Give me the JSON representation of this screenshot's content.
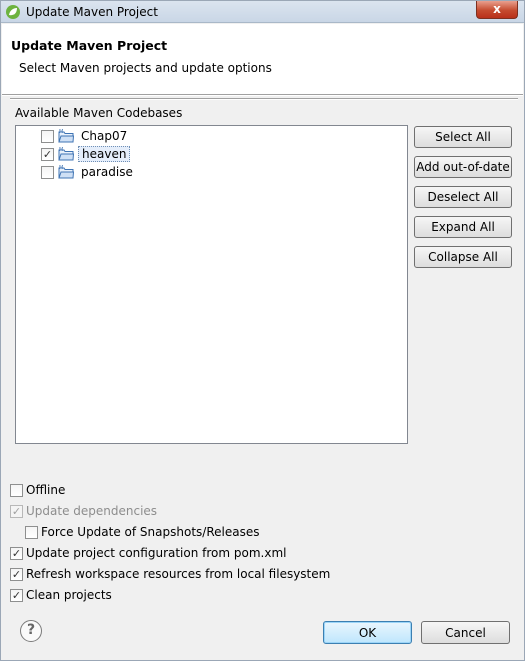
{
  "window": {
    "title": "Update Maven Project",
    "close_glyph": "x"
  },
  "header": {
    "title": "Update Maven Project",
    "subtitle": "Select Maven projects and update options"
  },
  "codebases": {
    "label": "Available Maven Codebases",
    "items": [
      {
        "label": "Chap07",
        "checked": false,
        "selected": false
      },
      {
        "label": "heaven",
        "checked": true,
        "selected": true
      },
      {
        "label": "paradise",
        "checked": false,
        "selected": false
      }
    ]
  },
  "side_buttons": {
    "select_all": "Select All",
    "add_out_of_date": "Add out-of-date",
    "deselect_all": "Deselect All",
    "expand_all": "Expand All",
    "collapse_all": "Collapse All"
  },
  "options": {
    "offline": {
      "label": "Offline",
      "checked": false
    },
    "update_dependencies": {
      "label": "Update dependencies",
      "checked": true,
      "enabled": false
    },
    "force_update": {
      "label": "Force Update of Snapshots/Releases",
      "checked": false
    },
    "update_config": {
      "label": "Update project configuration from pom.xml",
      "checked": true
    },
    "refresh_workspace": {
      "label": "Refresh workspace resources from local filesystem",
      "checked": true
    },
    "clean_projects": {
      "label": "Clean projects",
      "checked": true
    }
  },
  "footer": {
    "help_glyph": "?",
    "ok": "OK",
    "cancel": "Cancel"
  },
  "icons": {
    "app": "spring-leaf-icon",
    "folder": "maven-folder-icon",
    "help": "help-icon",
    "close": "close-icon"
  },
  "colors": {
    "selection": "#e5eefb",
    "default_button": "#bee6fd",
    "app_icon": "#6db33f"
  }
}
